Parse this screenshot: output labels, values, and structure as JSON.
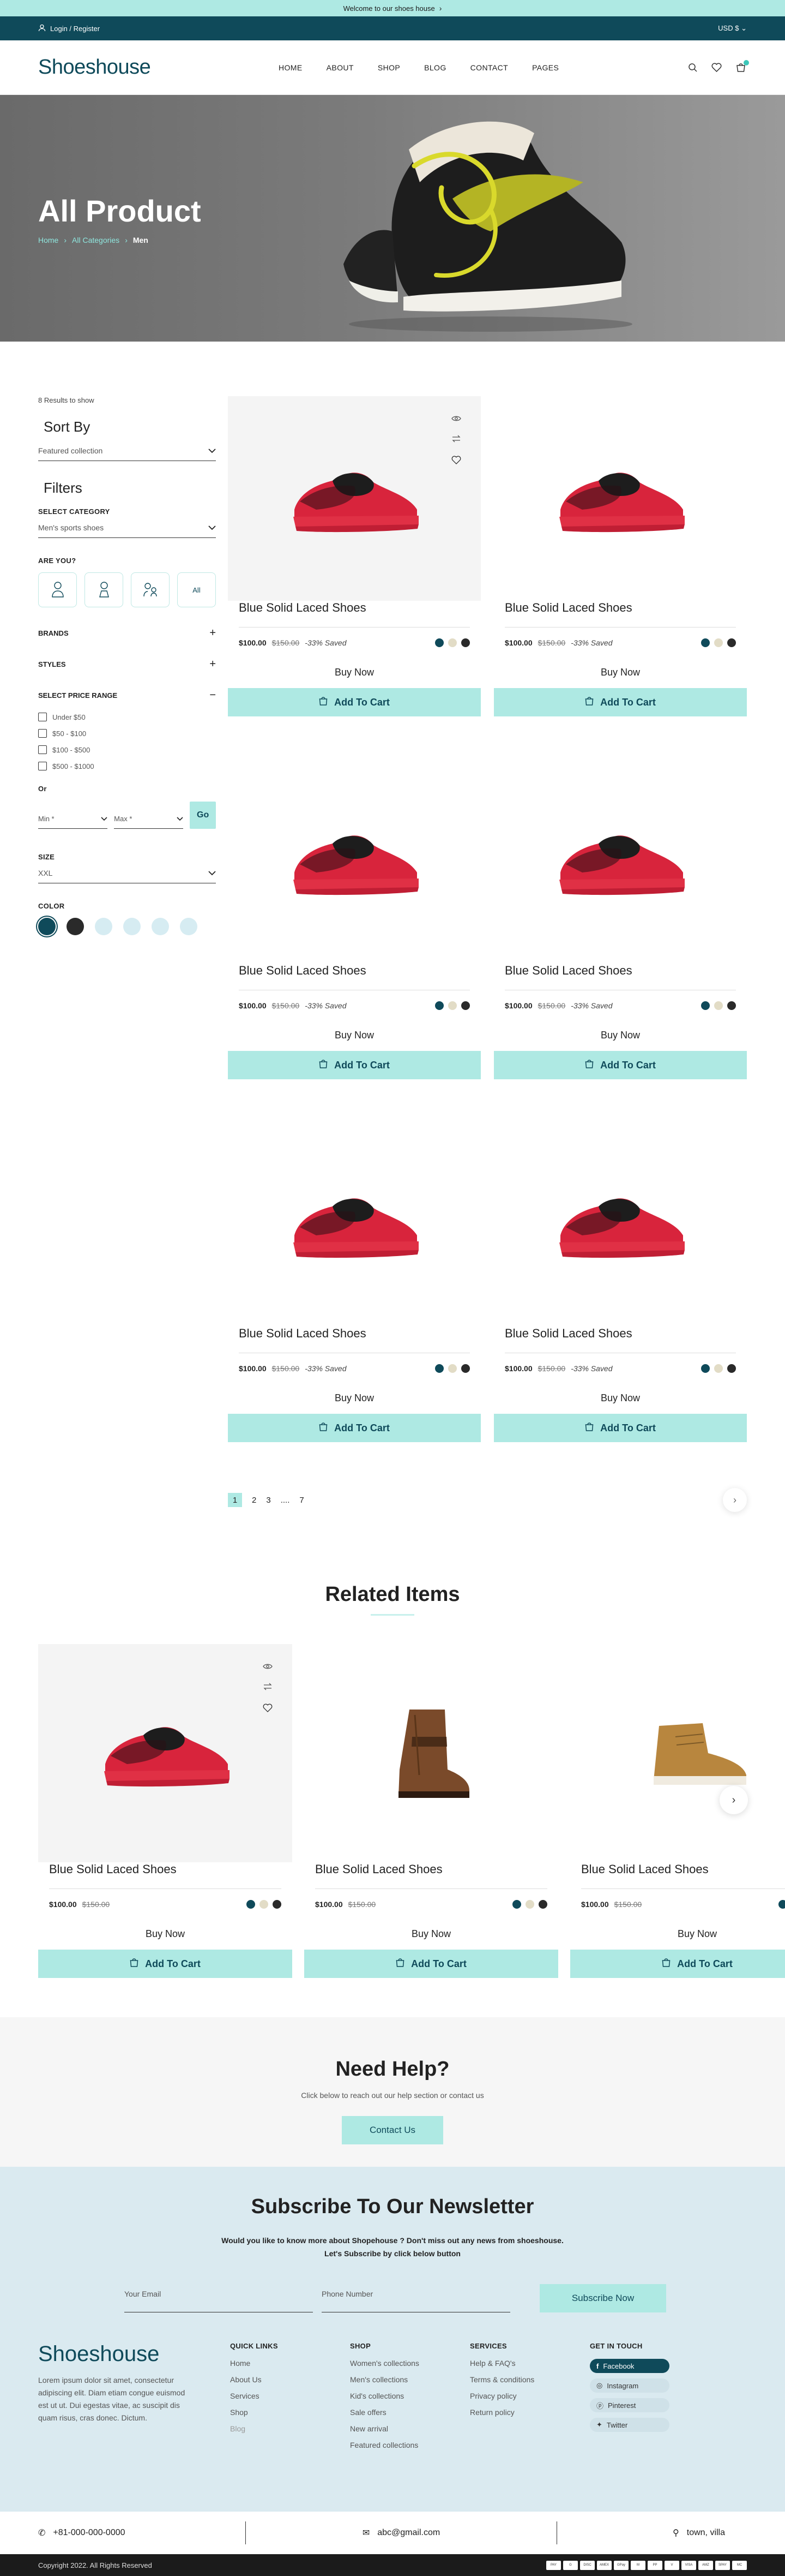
{
  "topbar": {
    "text": "Welcome to our shoes house"
  },
  "utilbar": {
    "login": "Login / Register",
    "currency": "USD $"
  },
  "header": {
    "logo": "Shoeshouse",
    "nav": [
      "HOME",
      "ABOUT",
      "SHOP",
      "BLOG",
      "CONTACT",
      "PAGES"
    ]
  },
  "hero": {
    "title": "All Product",
    "breadcrumb": [
      "Home",
      "All Categories",
      "Men"
    ]
  },
  "sidebar": {
    "results": "8 Results to show",
    "sort_heading": "Sort By",
    "sort_value": "Featured collection",
    "filters_heading": "Filters",
    "category_label": "SELECT CATEGORY",
    "category_value": "Men's sports shoes",
    "are_you_label": "ARE YOU?",
    "are_you_all": "All",
    "brands_label": "BRANDS",
    "styles_label": "STYLES",
    "price_label": "SELECT PRICE RANGE",
    "price_options": [
      "Under $50",
      "$50 - $100",
      "$100 - $500",
      "$500 - $1000"
    ],
    "or_label": "Or",
    "min_label": "Min *",
    "max_label": "Max *",
    "go_label": "Go",
    "size_label": "SIZE",
    "size_value": "XXL",
    "color_label": "COLOR",
    "colors": [
      "#0f4a5a",
      "#2a2a2a",
      "#d6ecf2",
      "#d6ecf2",
      "#d6ecf2",
      "#d6ecf2"
    ]
  },
  "products": [
    {
      "title": "Blue Solid Laced Shoes",
      "price": "$100.00",
      "old_price": "$150.00",
      "saved": "-33% Saved",
      "buy_now": "Buy Now",
      "add_to_cart": "Add To Cart"
    },
    {
      "title": "Blue Solid Laced Shoes",
      "price": "$100.00",
      "old_price": "$150.00",
      "saved": "-33% Saved",
      "buy_now": "Buy Now",
      "add_to_cart": "Add To Cart"
    },
    {
      "title": "Blue Solid Laced Shoes",
      "price": "$100.00",
      "old_price": "$150.00",
      "saved": "-33% Saved",
      "buy_now": "Buy Now",
      "add_to_cart": "Add To Cart"
    },
    {
      "title": "Blue Solid Laced Shoes",
      "price": "$100.00",
      "old_price": "$150.00",
      "saved": "-33% Saved",
      "buy_now": "Buy Now",
      "add_to_cart": "Add To Cart"
    },
    {
      "title": "Blue Solid Laced Shoes",
      "price": "$100.00",
      "old_price": "$150.00",
      "saved": "-33% Saved",
      "buy_now": "Buy Now",
      "add_to_cart": "Add To Cart"
    },
    {
      "title": "Blue Solid Laced Shoes",
      "price": "$100.00",
      "old_price": "$150.00",
      "saved": "-33% Saved",
      "buy_now": "Buy Now",
      "add_to_cart": "Add To Cart"
    }
  ],
  "swatch_colors": [
    "#0f4a5a",
    "#e2dcc6",
    "#2a2a2a"
  ],
  "pagination": {
    "pages": [
      "1",
      "2",
      "3",
      "....",
      "7"
    ]
  },
  "related": {
    "title": "Related Items",
    "items": [
      {
        "title": "Blue Solid Laced Shoes",
        "price": "$100.00",
        "old_price": "$150.00",
        "buy_now": "Buy Now",
        "add_to_cart": "Add To Cart"
      },
      {
        "title": "Blue Solid Laced Shoes",
        "price": "$100.00",
        "old_price": "$150.00",
        "buy_now": "Buy Now",
        "add_to_cart": "Add To Cart"
      },
      {
        "title": "Blue Solid Laced Shoes",
        "price": "$100.00",
        "old_price": "$150.00",
        "buy_now": "Buy Now",
        "add_to_cart": "Add To Cart"
      }
    ]
  },
  "help": {
    "title": "Need Help?",
    "text": "Click below to reach out our help section or contact us",
    "button": "Contact Us"
  },
  "newsletter": {
    "title": "Subscribe To Our Newsletter",
    "line1": "Would you like to know more about Shopehouse ? Don't miss out any news from shoeshouse.",
    "line2": "Let's Subscribe by click below button",
    "email_placeholder": "Your Email",
    "phone_placeholder": "Phone Number",
    "button": "Subscribe Now"
  },
  "footer": {
    "logo": "Shoeshouse",
    "about": "Lorem ipsum dolor sit amet, consectetur adipiscing elit. Diam etiam congue euismod est ut ut. Dui egestas vitae, ac suscipit dis quam risus, cras donec. Dictum.",
    "quick_links": {
      "title": "QUICK LINKS",
      "items": [
        "Home",
        "About Us",
        "Services",
        "Shop",
        "Blog"
      ]
    },
    "shop": {
      "title": "SHOP",
      "items": [
        "Women's collections",
        "Men's collections",
        "Kid's collections",
        "Sale offers",
        "New arrival",
        "Featured collections"
      ]
    },
    "services": {
      "title": "SERVICES",
      "items": [
        "Help & FAQ's",
        "Terms & conditions",
        "Privacy policy",
        "Return policy"
      ]
    },
    "get_in_touch": {
      "title": "GET IN TOUCH",
      "items": [
        "Facebook",
        "Instagram",
        "Pinterest",
        "Twitter"
      ]
    },
    "phone": "+81-000-000-0000",
    "email": "abc@gmail.com",
    "address": "town, villa",
    "copyright": "Copyright 2022. All Rights Reserved",
    "payments": [
      "PAY",
      "G",
      "DISC",
      "AMEX",
      "GPay",
      "M",
      "PP",
      "V",
      "VISA",
      "AMZ",
      "SPAY",
      "MC"
    ]
  }
}
